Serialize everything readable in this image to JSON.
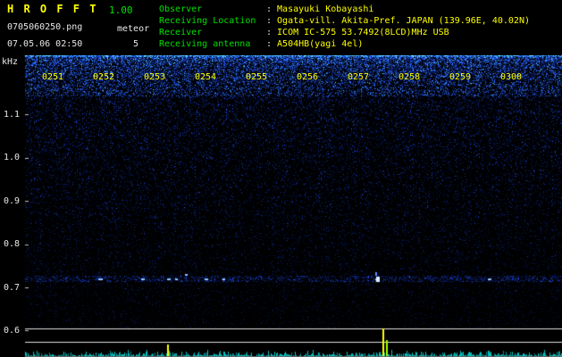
{
  "colors": {
    "background": "#000000",
    "accent_yellow": "#ffff00",
    "accent_green": "#00e000",
    "text_white": "#e8e8e8",
    "noise_blue": "#2233ff",
    "echo_blue": "#8fc4ff",
    "meter_cyan": "#00c0c0"
  },
  "header": {
    "app_name": "H R O F F T",
    "version": "1.00",
    "filename": "0705060250.png",
    "mode_label": "meteor",
    "timestamp": "07.05.06 02:50",
    "meteor_count": "5",
    "separator": ":",
    "info": [
      {
        "label": "Observer",
        "value": "Masayuki Kobayashi"
      },
      {
        "label": "Receiving Location",
        "value": "Ogata-vill. Akita-Pref. JAPAN (139.96E, 40.02N)"
      },
      {
        "label": "Receiver",
        "value": "ICOM IC-575 53.7492(8LCD)MHz USB"
      },
      {
        "label": "Receiving antenna",
        "value": "A504HB(yagi 4el)"
      }
    ]
  },
  "chart_data": {
    "type": "heatmap",
    "description": "10-minute radio meteor echo spectrogram (blue noise field, echoes near 0.72 kHz) with signal-level meter strip at bottom",
    "x_ticks": [
      "0251",
      "0252",
      "0253",
      "0254",
      "0255",
      "0256",
      "0257",
      "0258",
      "0259",
      "0300"
    ],
    "y_axis_unit": "kHz",
    "y_ticks": [
      "1.1",
      "1.0",
      "0.9",
      "0.8",
      "0.7",
      "0.6"
    ],
    "y_range_khz": [
      0.6,
      1.24
    ],
    "grid": false,
    "echo_band_khz": 0.72,
    "echoes": [
      {
        "t": 252.1,
        "f": 0.72,
        "w": 5,
        "strong": false
      },
      {
        "t": 252.95,
        "f": 0.72,
        "w": 4,
        "strong": false
      },
      {
        "t": 253.45,
        "f": 0.72,
        "w": 4,
        "strong": false
      },
      {
        "t": 253.62,
        "f": 0.72,
        "w": 3,
        "strong": false
      },
      {
        "t": 253.8,
        "f": 0.73,
        "w": 3,
        "strong": false
      },
      {
        "t": 254.2,
        "f": 0.72,
        "w": 4,
        "strong": false
      },
      {
        "t": 254.55,
        "f": 0.72,
        "w": 3,
        "strong": false
      },
      {
        "t": 257.55,
        "f": 0.72,
        "w": 5,
        "strong": true
      },
      {
        "t": 259.75,
        "f": 0.72,
        "w": 4,
        "strong": false
      }
    ],
    "signal_spikes": [
      {
        "t": 253.45,
        "h": 13,
        "color": "#ffff00"
      },
      {
        "t": 257.68,
        "h": 31,
        "color": "#ffff00"
      },
      {
        "t": 257.75,
        "h": 18,
        "color": "#a0ff00"
      },
      {
        "t": 259.75,
        "h": 6,
        "color": "#00c0c0"
      }
    ]
  }
}
